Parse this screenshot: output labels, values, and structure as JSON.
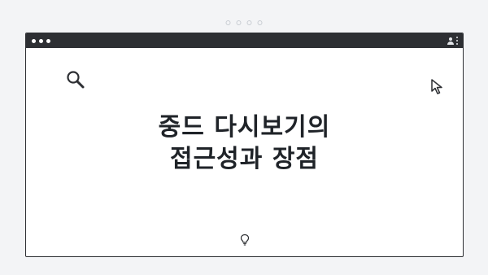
{
  "headline": {
    "line1": "중드 다시보기의",
    "line2": "접근성과 장점"
  },
  "icons": {
    "search": "search-icon",
    "cursor": "cursor-arrow-icon",
    "bulb": "lightbulb-icon",
    "user": "user-icon",
    "kebab": "kebab-menu-icon"
  },
  "colors": {
    "page_background": "#f3f4f6",
    "titlebar": "#2d2f33",
    "text": "#1f2328"
  }
}
